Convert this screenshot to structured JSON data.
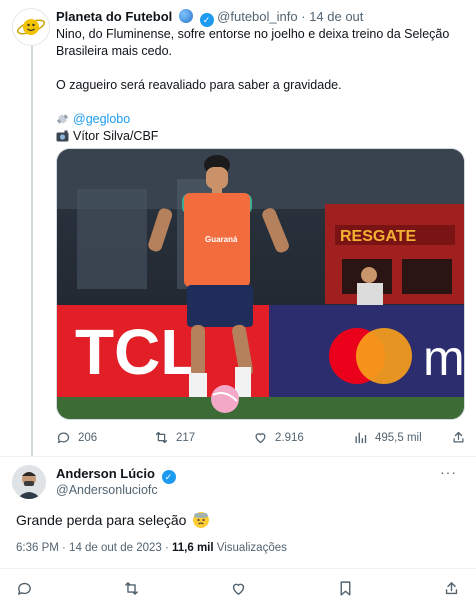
{
  "tweet": {
    "author_name": "Planeta do Futebol",
    "handle": "@futebol_info",
    "separator": "·",
    "date": "14 de out",
    "more": "···",
    "text_line1": "Nino, do Fluminense, sofre entorse no joelho e deixa treino da Seleção",
    "text_line2": "Brasileira mais cedo.",
    "text_line3": "O zagueiro será reavaliado para saber a gravidade.",
    "credit_link": "@geglobo",
    "credit_photo": "Vítor Silva/CBF",
    "photo": {
      "bib_brand": "Guaraná",
      "board_left": "TCL",
      "board_right": "m",
      "truck_text": "RESGATE"
    },
    "stats": {
      "replies": "206",
      "retweets": "217",
      "likes": "2.916",
      "views": "495,5 mil"
    }
  },
  "reply": {
    "author_name": "Anderson Lúcio",
    "handle": "@Andersonluciofc",
    "more": "···",
    "text": "Grande perda para seleção",
    "timestamp": "6:36 PM · 14 de out de 2023 ·",
    "views_count": "11,6 mil",
    "views_label": "Visualizações"
  },
  "colors": {
    "accent": "#1d9bf0",
    "text": "#0f1419",
    "muted": "#536471",
    "divider": "#eff3f4"
  },
  "icons": {
    "reply": "comment-icon",
    "retweet": "retweet-icon",
    "like": "heart-icon",
    "views": "views-bar-icon",
    "share": "share-icon",
    "bookmark": "bookmark-icon"
  }
}
